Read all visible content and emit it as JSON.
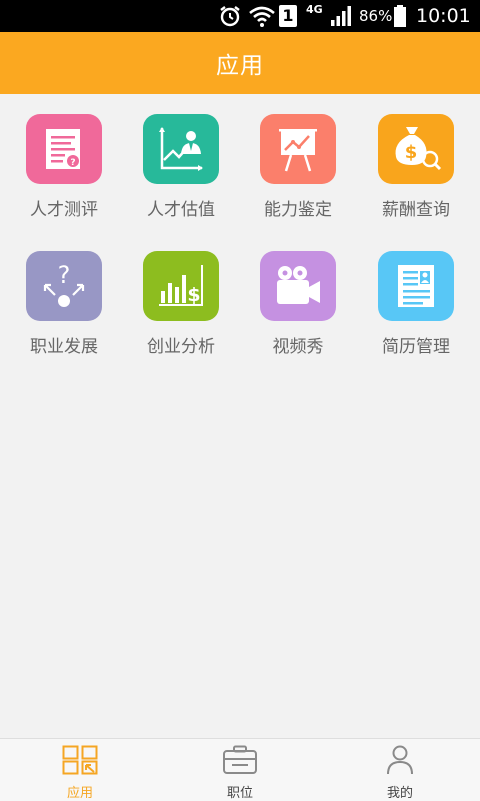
{
  "status_bar": {
    "network": "4G",
    "battery": "86%",
    "time": "10:01",
    "sim": "1"
  },
  "header": {
    "title": "应用"
  },
  "apps": [
    {
      "label": "人才测评",
      "icon": "assessment-report-icon",
      "color": "#f0699a"
    },
    {
      "label": "人才估值",
      "icon": "talent-valuation-chart-icon",
      "color": "#27b99a"
    },
    {
      "label": "能力鉴定",
      "icon": "presentation-board-icon",
      "color": "#fb7f6b"
    },
    {
      "label": "薪酬查询",
      "icon": "money-bag-search-icon",
      "color": "#f9a51c"
    },
    {
      "label": "职业发展",
      "icon": "career-question-icon",
      "color": "#9897c5"
    },
    {
      "label": "创业分析",
      "icon": "bar-chart-dollar-icon",
      "color": "#8dbd1f"
    },
    {
      "label": "视频秀",
      "icon": "video-camera-icon",
      "color": "#c591e1"
    },
    {
      "label": "简历管理",
      "icon": "resume-icon",
      "color": "#58c7f6"
    }
  ],
  "tabs": [
    {
      "label": "应用",
      "icon": "apps-grid-icon",
      "active": true
    },
    {
      "label": "职位",
      "icon": "briefcase-icon",
      "active": false
    },
    {
      "label": "我的",
      "icon": "person-icon",
      "active": false
    }
  ],
  "colors": {
    "accent": "#fba820",
    "background": "#f2f2f2"
  }
}
